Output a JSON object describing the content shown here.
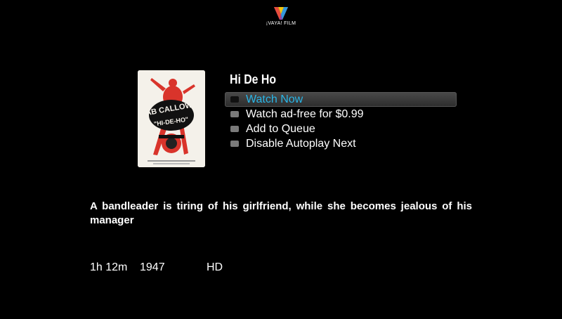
{
  "brand": {
    "name": "¡VAYA! FILM",
    "logo_icon": "v-logo-icon"
  },
  "movie": {
    "title": "Hi De Ho",
    "poster_icon": "movie-poster-image",
    "description": "A bandleader is tiring of his girlfriend, while she becomes jealous of his manager",
    "duration": "1h 12m",
    "year": "1947",
    "quality": "HD"
  },
  "menu": {
    "items": [
      {
        "label": "Watch Now",
        "selected": true
      },
      {
        "label": "Watch ad-free for $0.99",
        "selected": false
      },
      {
        "label": "Add to Queue",
        "selected": false
      },
      {
        "label": "Disable Autoplay Next",
        "selected": false
      }
    ]
  },
  "colors": {
    "background": "#000000",
    "selected_text": "#29b6e8",
    "text": "#ffffff"
  }
}
